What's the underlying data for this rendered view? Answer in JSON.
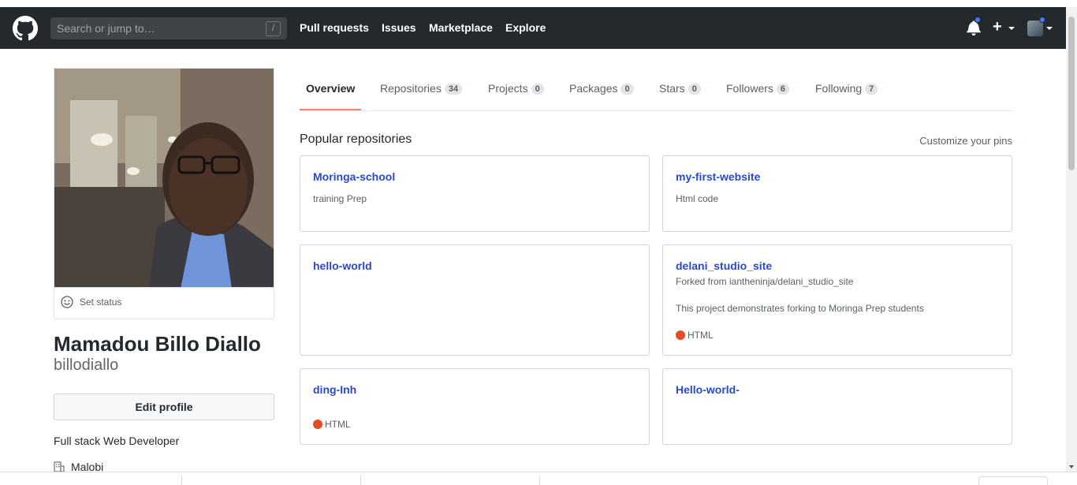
{
  "header": {
    "search_placeholder": "Search or jump to…",
    "search_shortcut": "/",
    "nav": [
      "Pull requests",
      "Issues",
      "Marketplace",
      "Explore"
    ],
    "plus_label": "+"
  },
  "profile": {
    "set_status": "Set status",
    "full_name": "Mamadou Billo Diallo",
    "username": "billodiallo",
    "edit_profile": "Edit profile",
    "bio": "Full stack Web Developer",
    "company": "Malobi"
  },
  "tabs": [
    {
      "label": "Overview",
      "count": ""
    },
    {
      "label": "Repositories",
      "count": "34"
    },
    {
      "label": "Projects",
      "count": "0"
    },
    {
      "label": "Packages",
      "count": "0"
    },
    {
      "label": "Stars",
      "count": "0"
    },
    {
      "label": "Followers",
      "count": "6"
    },
    {
      "label": "Following",
      "count": "7"
    }
  ],
  "popular": {
    "title": "Popular repositories",
    "customize": "Customize your pins",
    "repos": [
      {
        "name": "Moringa-school",
        "fork_note": "",
        "description": "training Prep",
        "language": ""
      },
      {
        "name": "my-first-website",
        "fork_note": "",
        "description": "Html code",
        "language": ""
      },
      {
        "name": "hello-world",
        "fork_note": "",
        "description": "",
        "language": ""
      },
      {
        "name": "delani_studio_site",
        "fork_note": "Forked from iantheninja/delani_studio_site",
        "description": "This project demonstrates forking to Moringa Prep students",
        "language": "HTML"
      },
      {
        "name": "ding-Inh",
        "fork_note": "",
        "description": "",
        "language": "HTML"
      },
      {
        "name": "Hello-world-",
        "fork_note": "",
        "description": "",
        "language": ""
      }
    ]
  },
  "colors": {
    "header_bg": "#24292e",
    "link": "#2a49c6",
    "html_lang": "#e34c26",
    "active_tab_underline": "#f9826c",
    "notification_dot": "#3e7bfd"
  }
}
